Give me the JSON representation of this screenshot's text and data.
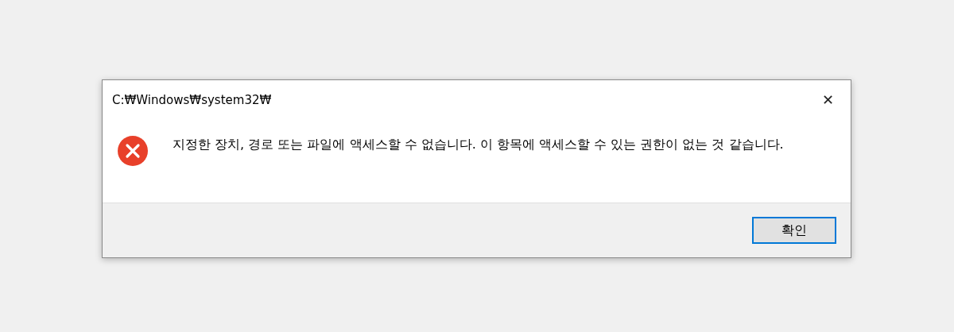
{
  "window": {
    "title": "C:₩Windows₩system32₩",
    "close": "✕"
  },
  "message": {
    "kind": "error",
    "text": "지정한 장치, 경로 또는 파일에 액세스할 수 없습니다. 이 항목에 액세스할 수 있는 권한이 없는 것 같습니다."
  },
  "buttons": [
    {
      "label": "확인",
      "selected": true
    }
  ]
}
